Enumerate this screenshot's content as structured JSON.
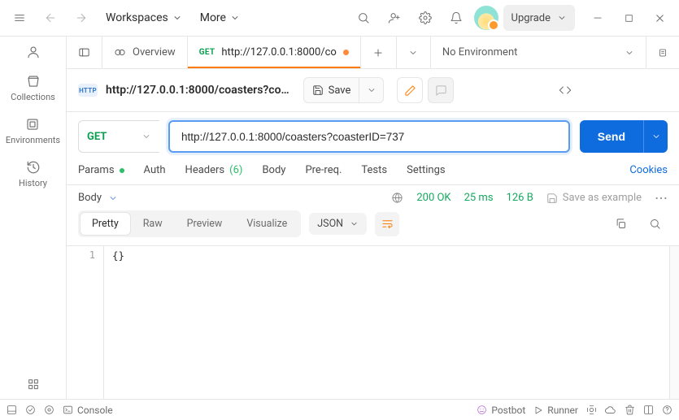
{
  "header": {
    "workspaces": "Workspaces",
    "more": "More",
    "upgrade": "Upgrade"
  },
  "leftrail": {
    "collections": "Collections",
    "environments": "Environments",
    "history": "History"
  },
  "tabs": {
    "overview": "Overview",
    "request_method": "GET",
    "request_title": "http://127.0.0.1:8000/co",
    "no_env": "No Environment"
  },
  "request": {
    "badge": "HTTP",
    "breadcrumb": "http://127.0.0.1:8000/coasters?coasterID=737",
    "save": "Save",
    "method": "GET",
    "url": "http://127.0.0.1:8000/coasters?coasterID=737",
    "send": "Send"
  },
  "reqtabs": {
    "params": "Params",
    "auth": "Auth",
    "headers": "Headers",
    "header_count": "(6)",
    "body": "Body",
    "prereq": "Pre-req.",
    "tests": "Tests",
    "settings": "Settings",
    "cookies": "Cookies"
  },
  "response": {
    "section": "Body",
    "status": "200 OK",
    "time": "25 ms",
    "size": "126 B",
    "save_example": "Save as example",
    "views": {
      "pretty": "Pretty",
      "raw": "Raw",
      "preview": "Preview",
      "visualize": "Visualize"
    },
    "format": "JSON",
    "line_number": "1",
    "body_text": "{}"
  },
  "footer": {
    "console": "Console",
    "postbot": "Postbot",
    "runner": "Runner"
  }
}
